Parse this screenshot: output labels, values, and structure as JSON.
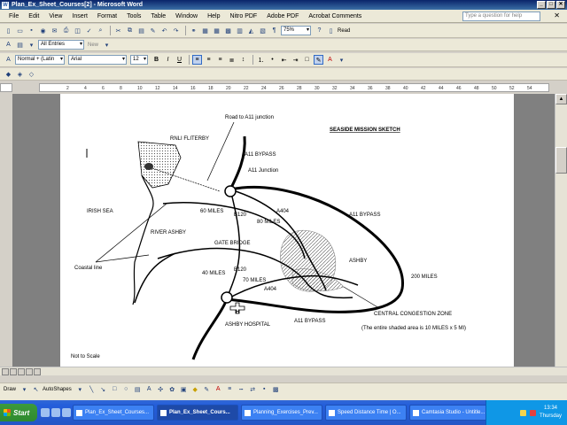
{
  "window": {
    "title": "Plan_Ex_Sheet_Courses[2] - Microsoft Word"
  },
  "menu": {
    "items": [
      "File",
      "Edit",
      "View",
      "Insert",
      "Format",
      "Tools",
      "Table",
      "Window",
      "Help",
      "Nitro PDF",
      "Adobe PDF",
      "Acrobat Comments"
    ],
    "help_placeholder": "Type a question for help"
  },
  "toolbar": {
    "zoom": "75%",
    "read_label": "Read",
    "style_dropdown": "All Entries",
    "new_label": "New",
    "style_name": "Normal + (Latin",
    "font_name": "Arial",
    "font_size": "12"
  },
  "ruler": {
    "ticks": [
      "2",
      "4",
      "6",
      "8",
      "10",
      "12",
      "14",
      "16",
      "18",
      "20",
      "22",
      "24",
      "26",
      "28",
      "30",
      "32",
      "34",
      "36",
      "38",
      "40",
      "42",
      "44",
      "46",
      "48",
      "50",
      "52",
      "54"
    ]
  },
  "sketch": {
    "title": "SEASIDE MISSION SKETCH",
    "road_to_junction": "Road to A11 junction",
    "rnli": "RNLI FLITERBY",
    "a11_bypass_top": "A11 BYPASS",
    "a11_junction": "A11 Junction",
    "irish_sea": "IRISH SEA",
    "sixty_miles_1": "60 MILES",
    "b120_top": "B120",
    "a404_top": "A404",
    "a11_bypass_right": "A11 BYPASS",
    "eighty_miles": "80 MILES",
    "river_ashby": "RIVER ASHBY",
    "gate_bridge": "GATE BRIDGE",
    "ashby": "ASHBY",
    "coastal_line": "Coastal line",
    "forty_miles": "40 MILES",
    "b120_bottom": "B120",
    "seventy_miles": "70 MILES",
    "two_hundred_miles": "200 MILES",
    "a404_bottom": "A404",
    "hospital_h": "H",
    "ashby_hospital": "ASHBY HOSPITAL",
    "a11_bypass_bottom": "A11 BYPASS",
    "central_zone": "CENTRAL CONGESTION ZONE",
    "central_zone_note": "(The entire shaded area is 10 MILES x 5 MI)",
    "not_to_scale": "Not to Scale"
  },
  "drawbar": {
    "draw_label": "Draw",
    "autoshapes_label": "AutoShapes"
  },
  "taskbar": {
    "start_label": "Start",
    "tasks": [
      "Plan_Ex_Sheet_Courses...",
      "Plan_Ex_Sheet_Cours...",
      "Planning_Exercises_Prev...",
      "Speed Distance Time | O...",
      "Camtasia Studio - Untitle..."
    ],
    "time": "13:34",
    "day": "Thursday"
  }
}
